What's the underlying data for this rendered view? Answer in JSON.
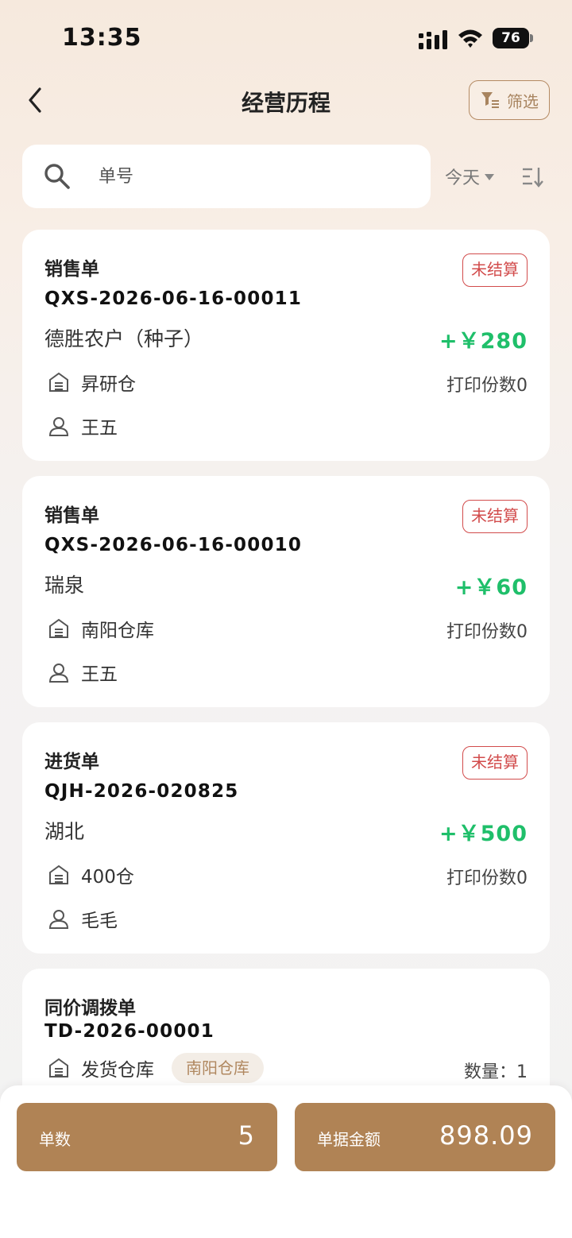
{
  "status_bar": {
    "time": "13:35",
    "battery": "76"
  },
  "nav": {
    "title": "经营历程",
    "filter_label": "筛选"
  },
  "search": {
    "placeholder": "单号",
    "date_filter": "今天"
  },
  "colors": {
    "accent": "#b08355",
    "amount_positive": "#1fbf6a",
    "badge_unsettled": "#d24c4c"
  },
  "cards": [
    {
      "type": "销售单",
      "status": "未结算",
      "number": "QXS-2026-06-16-00011",
      "party": "德胜农户（种子）",
      "amount": "+￥280",
      "warehouse": "昇研仓",
      "print_count": "打印份数0",
      "operator": "王五"
    },
    {
      "type": "销售单",
      "status": "未结算",
      "number": "QXS-2026-06-16-00010",
      "party": "瑞泉",
      "amount": "+￥60",
      "warehouse": "南阳仓库",
      "print_count": "打印份数0",
      "operator": "王五"
    },
    {
      "type": "进货单",
      "status": "未结算",
      "number": "QJH-2026-020825",
      "party": "湖北",
      "amount": "+￥500",
      "warehouse": "400仓",
      "print_count": "打印份数0",
      "operator": "毛毛"
    },
    {
      "type": "同价调拨单",
      "number": "TD-2026-00001",
      "ship_label": "发货仓库",
      "ship_warehouse": "南阳仓库",
      "qty_label": "数量：",
      "qty": "1"
    }
  ],
  "footer": {
    "count_label": "单数",
    "count_value": "5",
    "amount_label": "单据金额",
    "amount_value": "898.09"
  }
}
